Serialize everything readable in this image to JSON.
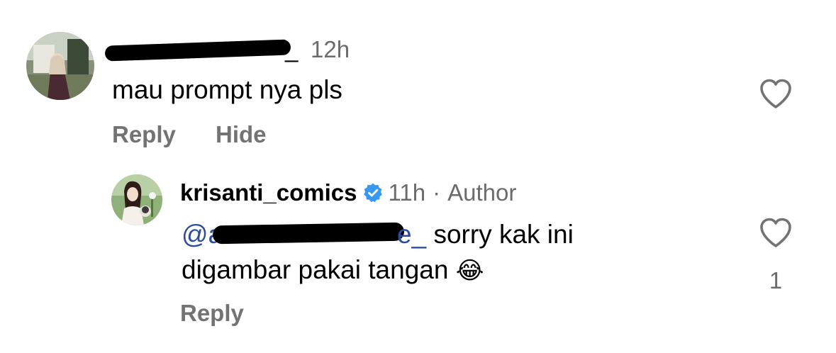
{
  "comments": [
    {
      "username_suffix": "_",
      "time": "12h",
      "text": "mau prompt nya pls",
      "actions": {
        "reply": "Reply",
        "hide": "Hide"
      },
      "like_count": ""
    }
  ],
  "reply": {
    "username": "krisanti_comics",
    "time": "11h",
    "separator": "·",
    "role": "Author",
    "mention_prefix": "@a",
    "mention_suffix": "e_",
    "text_line1": "sorry kak ini",
    "text_line2": "digambar pakai tangan",
    "emoji": "😂",
    "actions": {
      "reply": "Reply"
    },
    "like_count": "1"
  },
  "icons": {
    "like": "heart-icon",
    "verified": "verified-badge-icon",
    "verified_color": "#3897f0"
  }
}
